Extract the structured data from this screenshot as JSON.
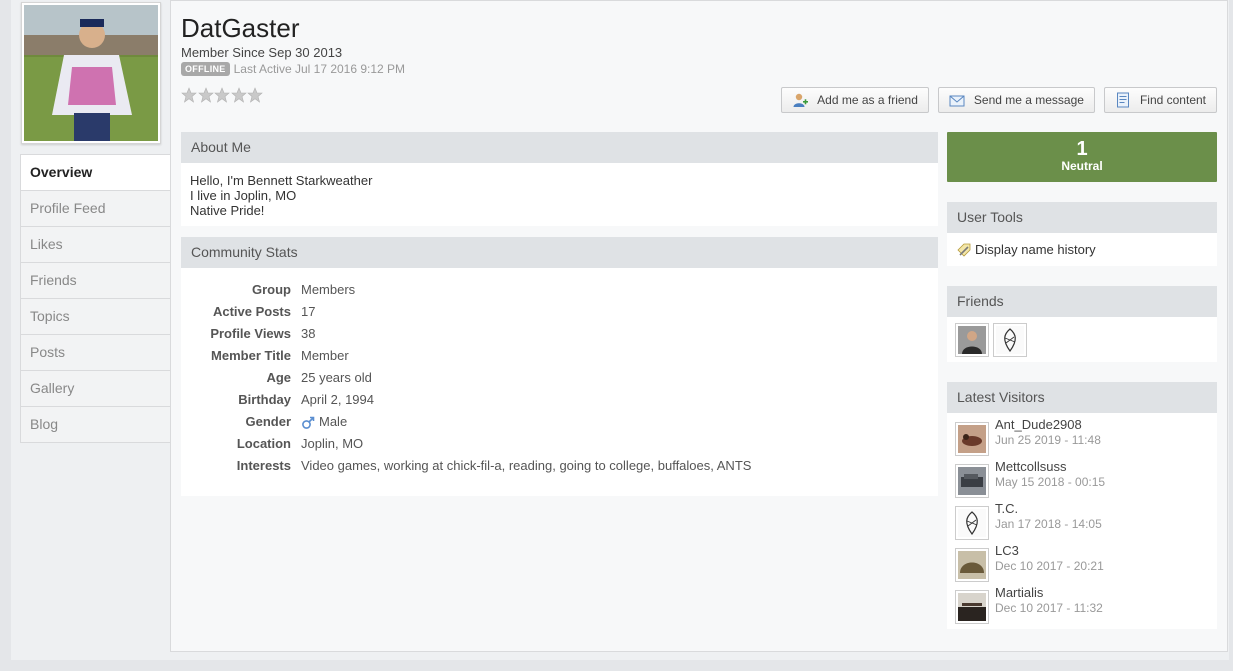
{
  "profile": {
    "name": "DatGaster",
    "member_since": "Member Since Sep 30 2013",
    "status_badge": "OFFLINE",
    "last_active": "Last Active Jul 17 2016 9:12 PM",
    "rating_stars": 0,
    "rating_max": 5
  },
  "actions": {
    "add_friend": "Add me as a friend",
    "send_message": "Send me a message",
    "find_content": "Find content"
  },
  "tabs": [
    {
      "label": "Overview",
      "active": true
    },
    {
      "label": "Profile Feed"
    },
    {
      "label": "Likes"
    },
    {
      "label": "Friends"
    },
    {
      "label": "Topics"
    },
    {
      "label": "Posts"
    },
    {
      "label": "Gallery"
    },
    {
      "label": "Blog"
    }
  ],
  "about": {
    "title": "About Me",
    "lines": [
      "Hello, I'm Bennett Starkweather",
      "I live in Joplin, MO",
      "Native Pride!"
    ]
  },
  "stats": {
    "title": "Community Stats",
    "rows": [
      {
        "label": "Group",
        "value": "Members"
      },
      {
        "label": "Active Posts",
        "value": "17"
      },
      {
        "label": "Profile Views",
        "value": "38"
      },
      {
        "label": "Member Title",
        "value": "Member"
      },
      {
        "label": "Age",
        "value": "25 years old"
      },
      {
        "label": "Birthday",
        "value": "April 2, 1994"
      },
      {
        "label": "Gender",
        "value": "Male",
        "icon": "male-icon"
      },
      {
        "label": "Location",
        "value": "Joplin, MO"
      },
      {
        "label": "Interests",
        "value": "Video games, working at chick-fil-a, reading, going to college, buffaloes, ANTS"
      }
    ]
  },
  "reputation": {
    "value": "1",
    "label": "Neutral",
    "color": "#6b8f4a"
  },
  "user_tools": {
    "title": "User Tools",
    "item": "Display name history"
  },
  "friends": {
    "title": "Friends",
    "count": 2
  },
  "visitors": {
    "title": "Latest Visitors",
    "items": [
      {
        "name": "Ant_Dude2908",
        "time": "Jun 25 2019 - 11:48"
      },
      {
        "name": "Mettcollsuss",
        "time": "May 15 2018 - 00:15"
      },
      {
        "name": "T.C.",
        "time": "Jan 17 2018 - 14:05"
      },
      {
        "name": "LC3",
        "time": "Dec 10 2017 - 20:21"
      },
      {
        "name": "Martialis",
        "time": "Dec 10 2017 - 11:32"
      }
    ]
  }
}
